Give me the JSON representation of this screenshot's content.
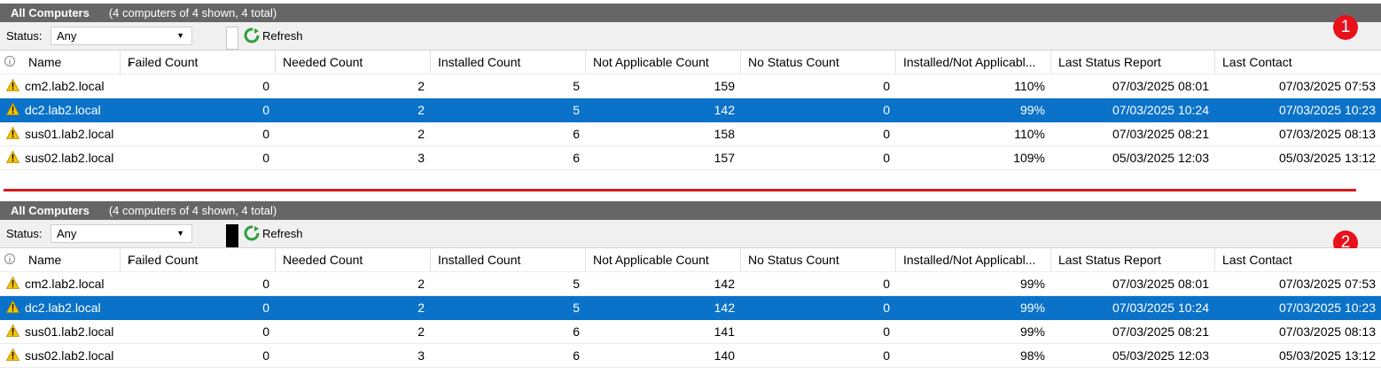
{
  "columns": [
    "Name",
    "Failed Count",
    "Needed Count",
    "Installed Count",
    "Not Applicable Count",
    "No Status Count",
    "Installed/Not Applicabl...",
    "Last Status Report",
    "Last Contact"
  ],
  "panels": [
    {
      "title": "All Computers",
      "subtitle": "(4 computers of 4 shown, 4 total)",
      "status_label": "Status:",
      "status_value": "Any",
      "refresh_label": "Refresh",
      "badge": "1",
      "rows": [
        {
          "name": "cm2.lab2.local",
          "failed": "0",
          "needed": "2",
          "installed": "5",
          "not_applicable": "159",
          "no_status": "0",
          "pct": "110%",
          "last_status": "07/03/2025 08:01",
          "last_contact": "07/03/2025 07:53"
        },
        {
          "name": "dc2.lab2.local",
          "failed": "0",
          "needed": "2",
          "installed": "5",
          "not_applicable": "142",
          "no_status": "0",
          "pct": "99%",
          "last_status": "07/03/2025 10:24",
          "last_contact": "07/03/2025 10:23"
        },
        {
          "name": "sus01.lab2.local",
          "failed": "0",
          "needed": "2",
          "installed": "6",
          "not_applicable": "158",
          "no_status": "0",
          "pct": "110%",
          "last_status": "07/03/2025 08:21",
          "last_contact": "07/03/2025 08:13"
        },
        {
          "name": "sus02.lab2.local",
          "failed": "0",
          "needed": "3",
          "installed": "6",
          "not_applicable": "157",
          "no_status": "0",
          "pct": "109%",
          "last_status": "05/03/2025 12:03",
          "last_contact": "05/03/2025 13:12"
        }
      ]
    },
    {
      "title": "All Computers",
      "subtitle": "(4 computers of 4 shown, 4 total)",
      "status_label": "Status:",
      "status_value": "Any",
      "refresh_label": "Refresh",
      "badge": "2",
      "rows": [
        {
          "name": "cm2.lab2.local",
          "failed": "0",
          "needed": "2",
          "installed": "5",
          "not_applicable": "142",
          "no_status": "0",
          "pct": "99%",
          "last_status": "07/03/2025 08:01",
          "last_contact": "07/03/2025 07:53"
        },
        {
          "name": "dc2.lab2.local",
          "failed": "0",
          "needed": "2",
          "installed": "5",
          "not_applicable": "142",
          "no_status": "0",
          "pct": "99%",
          "last_status": "07/03/2025 10:24",
          "last_contact": "07/03/2025 10:23"
        },
        {
          "name": "sus01.lab2.local",
          "failed": "0",
          "needed": "2",
          "installed": "6",
          "not_applicable": "141",
          "no_status": "0",
          "pct": "99%",
          "last_status": "07/03/2025 08:21",
          "last_contact": "07/03/2025 08:13"
        },
        {
          "name": "sus02.lab2.local",
          "failed": "0",
          "needed": "3",
          "installed": "6",
          "not_applicable": "140",
          "no_status": "0",
          "pct": "98%",
          "last_status": "05/03/2025 12:03",
          "last_contact": "05/03/2025 13:12"
        }
      ]
    }
  ],
  "selected_row_index": 1,
  "icons": {
    "info": "info-icon",
    "sort": "sort-ascending-icon",
    "row": "warning-icon",
    "refresh": "refresh-icon",
    "dropdown": "chevron-down-icon"
  },
  "colors": {
    "header_bg": "#666666",
    "selection": "#0a72c9",
    "badge": "#e8101a",
    "divider": "#d7191c",
    "refresh_icon": "#2e9e3e",
    "warning": "#f5c400"
  }
}
